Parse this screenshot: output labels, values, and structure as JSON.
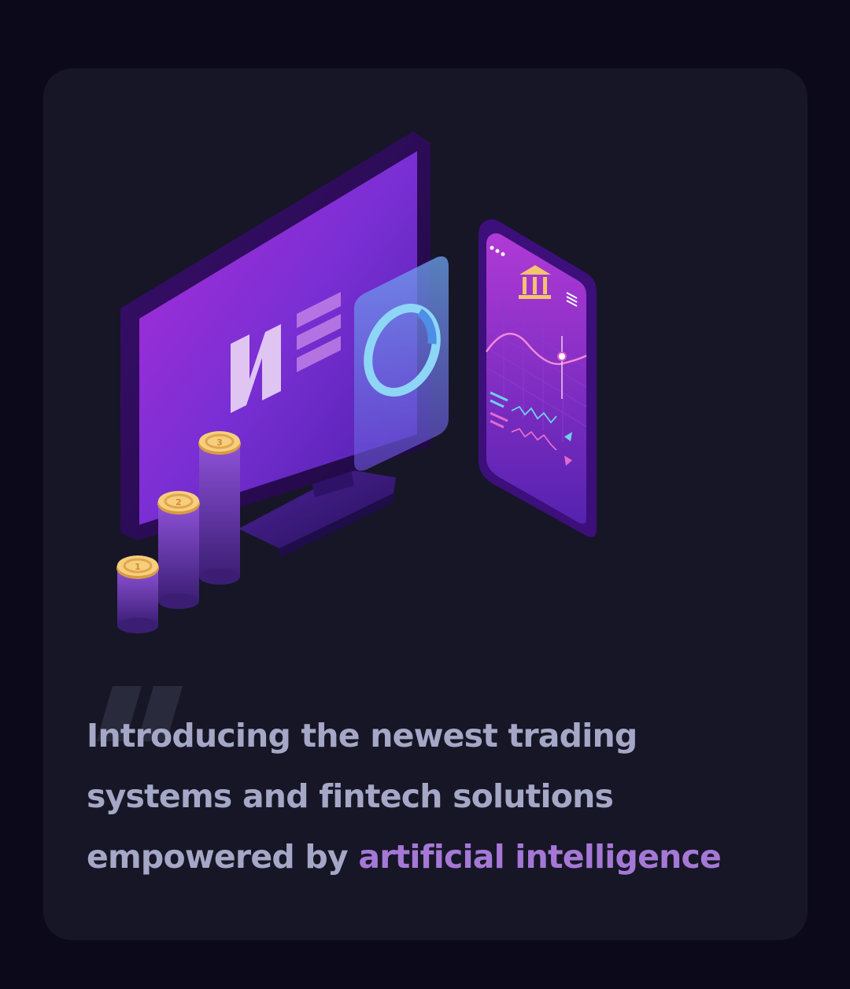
{
  "colors": {
    "page_background": "#0c0a1a",
    "card_background": "#161626",
    "text": "#a5a7c6",
    "highlight": "#a578d6",
    "accent_purple": "#8a2be2",
    "coin_gold": "#f3c46e"
  },
  "illustration": {
    "description_icons": [
      "monitor-icon",
      "donut-chart-icon",
      "smartphone-icon",
      "bank-icon",
      "coin-stack-icon"
    ],
    "monitor_logo": "NEO",
    "coin_labels": [
      "1",
      "2",
      "3"
    ]
  },
  "headline": {
    "line1": "Introducing the newest trading",
    "line2": "systems and fintech solutions",
    "line3_prefix": "empowered by ",
    "line3_highlight": "artificial intelligence"
  }
}
